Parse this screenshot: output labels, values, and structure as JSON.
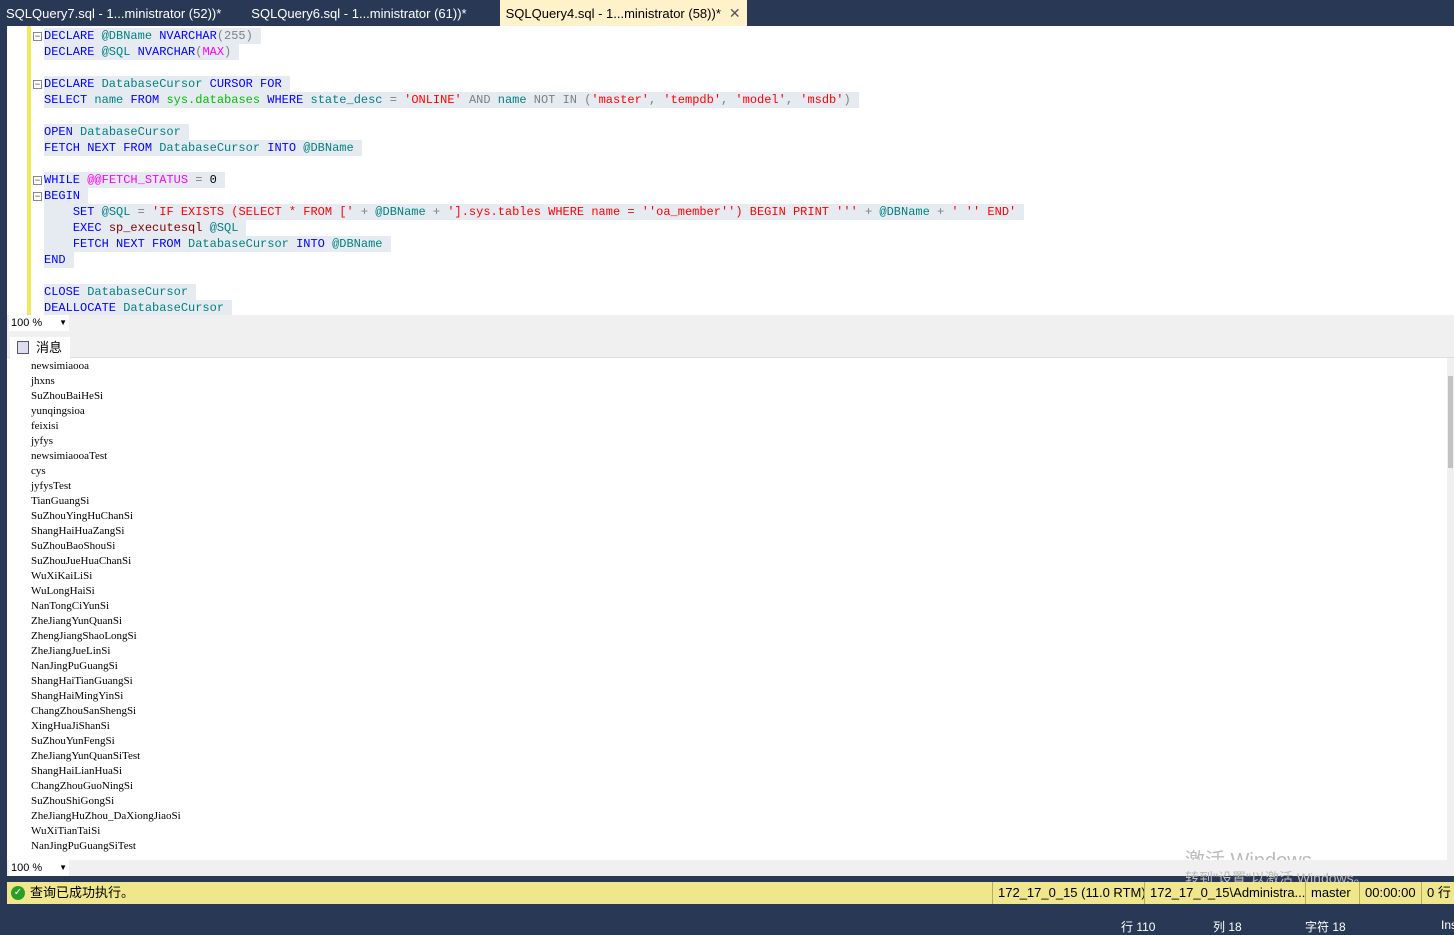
{
  "tabs": [
    {
      "label": "SQLQuery7.sql - 1...ministrator (52))*"
    },
    {
      "label": "SQLQuery6.sql - 1...ministrator (61))*"
    },
    {
      "label": "SQLQuery4.sql - 1...ministrator (58))*",
      "close": "✕"
    }
  ],
  "editor": {
    "lines": [
      {
        "fold": true,
        "indent": 0,
        "tokens": [
          [
            "DECLARE ",
            "kw"
          ],
          [
            "@DBName ",
            "id"
          ],
          [
            "NVARCHAR",
            "kw"
          ],
          [
            "(255)",
            "op"
          ]
        ]
      },
      {
        "fold": false,
        "indent": 0,
        "tokens": [
          [
            "DECLARE ",
            "kw"
          ],
          [
            "@SQL ",
            "id"
          ],
          [
            "NVARCHAR",
            "kw"
          ],
          [
            "(",
            "op"
          ],
          [
            "MAX",
            "fn"
          ],
          [
            ")",
            "op"
          ]
        ]
      },
      null,
      {
        "fold": true,
        "indent": 0,
        "tokens": [
          [
            "DECLARE ",
            "kw"
          ],
          [
            "DatabaseCursor ",
            "id"
          ],
          [
            "CURSOR FOR",
            "kw"
          ]
        ]
      },
      {
        "fold": false,
        "indent": 0,
        "tokens": [
          [
            "SELECT ",
            "kw"
          ],
          [
            "name ",
            "id"
          ],
          [
            "FROM ",
            "kw"
          ],
          [
            "sys.databases ",
            "sys"
          ],
          [
            "WHERE ",
            "kw"
          ],
          [
            "state_desc ",
            "id"
          ],
          [
            "= ",
            "op"
          ],
          [
            "'ONLINE' ",
            "str"
          ],
          [
            "AND ",
            "op"
          ],
          [
            "name ",
            "id"
          ],
          [
            "NOT IN ",
            "op"
          ],
          [
            "(",
            "op"
          ],
          [
            "'master'",
            "str"
          ],
          [
            ", ",
            "op"
          ],
          [
            "'tempdb'",
            "str"
          ],
          [
            ", ",
            "op"
          ],
          [
            "'model'",
            "str"
          ],
          [
            ", ",
            "op"
          ],
          [
            "'msdb'",
            "str"
          ],
          [
            ")",
            "op"
          ]
        ]
      },
      null,
      {
        "fold": false,
        "indent": 0,
        "tokens": [
          [
            "OPEN ",
            "kw"
          ],
          [
            "DatabaseCursor",
            "id"
          ]
        ]
      },
      {
        "fold": false,
        "indent": 0,
        "tokens": [
          [
            "FETCH NEXT FROM ",
            "kw"
          ],
          [
            "DatabaseCursor ",
            "id"
          ],
          [
            "INTO ",
            "kw"
          ],
          [
            "@DBName",
            "id"
          ]
        ]
      },
      null,
      {
        "fold": true,
        "indent": 0,
        "tokens": [
          [
            "WHILE ",
            "kw"
          ],
          [
            "@@FETCH_STATUS ",
            "fn"
          ],
          [
            "= ",
            "op"
          ],
          [
            "0",
            "tx"
          ]
        ]
      },
      {
        "fold": true,
        "indent": 0,
        "tokens": [
          [
            "BEGIN",
            "kw"
          ]
        ]
      },
      {
        "fold": false,
        "indent": 4,
        "tokens": [
          [
            "SET ",
            "kw"
          ],
          [
            "@SQL ",
            "id"
          ],
          [
            "= ",
            "op"
          ],
          [
            "'IF EXISTS (SELECT * FROM [' ",
            "str"
          ],
          [
            "+ ",
            "op"
          ],
          [
            "@DBName ",
            "id"
          ],
          [
            "+ ",
            "op"
          ],
          [
            "'].sys.tables WHERE name = ''oa_member'') BEGIN PRINT ''' ",
            "str"
          ],
          [
            "+ ",
            "op"
          ],
          [
            "@DBName ",
            "id"
          ],
          [
            "+ ",
            "op"
          ],
          [
            "' '' END'",
            "str"
          ]
        ]
      },
      {
        "fold": false,
        "indent": 4,
        "tokens": [
          [
            "EXEC ",
            "kw"
          ],
          [
            "sp_executesql ",
            "pr"
          ],
          [
            "@SQL",
            "id"
          ]
        ]
      },
      {
        "fold": false,
        "indent": 4,
        "tokens": [
          [
            "FETCH NEXT FROM ",
            "kw"
          ],
          [
            "DatabaseCursor ",
            "id"
          ],
          [
            "INTO ",
            "kw"
          ],
          [
            "@DBName",
            "id"
          ]
        ]
      },
      {
        "fold": false,
        "indent": 0,
        "tokens": [
          [
            "END",
            "kw"
          ]
        ]
      },
      null,
      {
        "fold": false,
        "indent": 0,
        "tokens": [
          [
            "CLOSE ",
            "kw"
          ],
          [
            "DatabaseCursor",
            "id"
          ]
        ]
      },
      {
        "fold": false,
        "indent": 0,
        "tokens": [
          [
            "DEALLOCATE ",
            "kw"
          ],
          [
            "DatabaseCursor",
            "id"
          ]
        ]
      }
    ]
  },
  "zoom": {
    "value": "100 %"
  },
  "results": {
    "tab_label": "消息",
    "messages": [
      "newsimiaooa",
      "jhxns",
      "SuZhouBaiHeSi",
      "yunqingsioa",
      "feixisi",
      "jyfys",
      "newsimiaooaTest",
      "cys",
      "jyfysTest",
      "TianGuangSi",
      "SuZhouYingHuChanSi",
      "ShangHaiHuaZangSi",
      "SuZhouBaoShouSi",
      "SuZhouJueHuaChanSi",
      "WuXiKaiLiSi",
      "WuLongHaiSi",
      "NanTongCiYunSi",
      "ZheJiangYunQuanSi",
      "ZhengJiangShaoLongSi",
      "ZheJiangJueLinSi",
      "NanJingPuGuangSi",
      "ShangHaiTianGuangSi",
      "ShangHaiMingYinSi",
      "ChangZhouSanShengSi",
      "XingHuaJiShanSi",
      "SuZhouYunFengSi",
      "ZheJiangYunQuanSiTest",
      "ShangHaiLianHuaSi",
      "ChangZhouGuoNingSi",
      "SuZhouShiGongSi",
      "ZheJiangHuZhou_DaXiongJiaoSi",
      "WuXiTianTaiSi",
      "NanJingPuGuangSiTest"
    ]
  },
  "status": {
    "message": "查询已成功执行。",
    "server": "172_17_0_15 (11.0 RTM)",
    "user": "172_17_0_15\\Administra...",
    "database": "master",
    "time": "00:00:00",
    "rows": "0 行"
  },
  "bottom": {
    "line": "行 110",
    "col": "列 18",
    "char": "字符 18",
    "mode": "Ins"
  },
  "watermark": {
    "title": "激活 Windows",
    "subtitle": "转到\"设置\"以激活 Windows。"
  }
}
